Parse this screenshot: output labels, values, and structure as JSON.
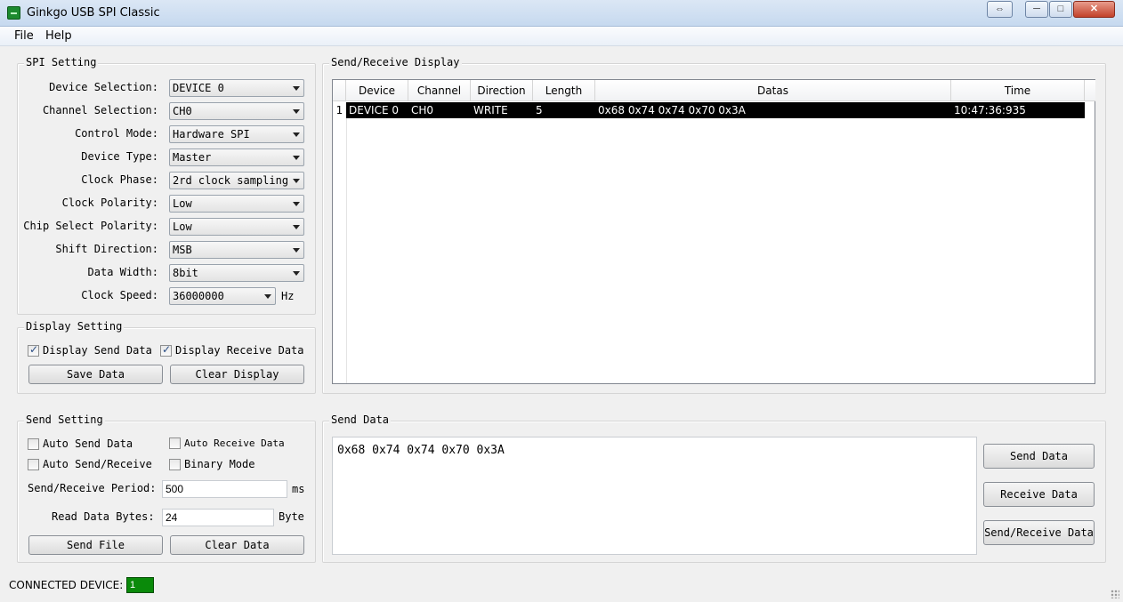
{
  "window": {
    "title": "Ginkgo USB SPI Classic",
    "restore_glyph": "⇔",
    "min_glyph": "─",
    "max_glyph": "□",
    "close_glyph": "✕"
  },
  "menu": {
    "file": "File",
    "help": "Help"
  },
  "spi": {
    "title": "SPI Setting",
    "device_selection": {
      "label": "Device Selection:",
      "value": "DEVICE 0"
    },
    "channel_selection": {
      "label": "Channel Selection:",
      "value": "CH0"
    },
    "control_mode": {
      "label": "Control Mode:",
      "value": "Hardware SPI"
    },
    "device_type": {
      "label": "Device Type:",
      "value": "Master"
    },
    "clock_phase": {
      "label": "Clock Phase:",
      "value": "2rd clock sampling"
    },
    "clock_polarity": {
      "label": "Clock Polarity:",
      "value": "Low"
    },
    "cs_polarity": {
      "label": "Chip Select Polarity:",
      "value": "Low"
    },
    "shift_direction": {
      "label": "Shift Direction:",
      "value": "MSB"
    },
    "data_width": {
      "label": "Data Width:",
      "value": "8bit"
    },
    "clock_speed": {
      "label": "Clock Speed:",
      "value": "36000000",
      "unit": "Hz"
    }
  },
  "display": {
    "title": "Display Setting",
    "send_data": {
      "label": "Display Send Data",
      "checked": true
    },
    "receive_data": {
      "label": "Display Receive Data",
      "checked": true
    },
    "save_button": "Save Data",
    "clear_button": "Clear Display"
  },
  "send_setting": {
    "title": "Send Setting",
    "auto_send": {
      "label": "Auto Send Data",
      "checked": false
    },
    "auto_receive": {
      "label": "Auto Receive Data",
      "checked": false
    },
    "auto_send_receive": {
      "label": "Auto Send/Receive",
      "checked": false
    },
    "binary_mode": {
      "label": "Binary Mode",
      "checked": false
    },
    "period": {
      "label": "Send/Receive Period:",
      "value": "500",
      "unit": "ms"
    },
    "read_bytes": {
      "label": "Read Data Bytes:",
      "value": "24",
      "unit": "Byte"
    },
    "send_file_button": "Send File",
    "clear_data_button": "Clear Data"
  },
  "display_table": {
    "title": "Send/Receive Display",
    "columns": [
      "Device",
      "Channel",
      "Direction",
      "Length",
      "Datas",
      "Time"
    ],
    "rows": [
      {
        "num": "1",
        "device": "DEVICE 0",
        "channel": "CH0",
        "direction": "WRITE",
        "length": "5",
        "datas": "0x68 0x74 0x74 0x70 0x3A",
        "time": "10:47:36:935"
      }
    ]
  },
  "send_data": {
    "title": "Send Data",
    "content": "0x68 0x74 0x74 0x70 0x3A",
    "send_button": "Send Data",
    "receive_button": "Receive Data",
    "send_receive_button": "Send/Receive Data"
  },
  "status": {
    "label": "CONNECTED DEVICE:",
    "value": "1",
    "accent": "#0a8a0a"
  }
}
